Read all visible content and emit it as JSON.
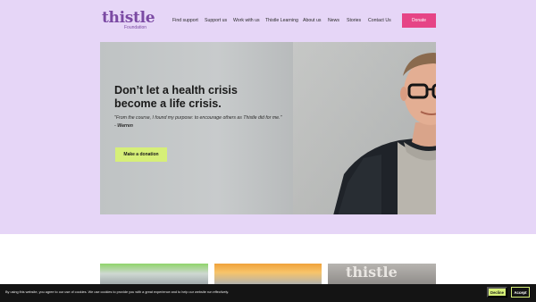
{
  "brand": {
    "name": "thistle",
    "sub": "Foundation",
    "color": "#7b4aa3"
  },
  "nav": {
    "items": [
      {
        "label": "Find support"
      },
      {
        "label": "Support us"
      },
      {
        "label": "Work with us"
      },
      {
        "label": "Thistle Learning"
      },
      {
        "label": "About us"
      },
      {
        "label": "News"
      },
      {
        "label": "Stories"
      },
      {
        "label": "Contact Us"
      }
    ],
    "donate_label": "Donate"
  },
  "hero": {
    "title": "Don’t let a health crisis become a life crisis.",
    "quote": "\"From the course, I found my purpose: to encourage others as Thistle did for me.\" -",
    "quote_author": "Warren",
    "cta_label": "Make a donation"
  },
  "cards": {
    "card3_text": "thistle"
  },
  "cookie": {
    "text": "By using this website, you agree to our use of cookies. We use cookies to provide you with a great experience and to help our website run effectively.",
    "decline_label": "Decline",
    "accept_label": "Accept"
  },
  "colors": {
    "background": "#e6d6f7",
    "donate": "#e64486",
    "accent_lime": "#d6ef78",
    "cookie_bar": "#141414"
  }
}
